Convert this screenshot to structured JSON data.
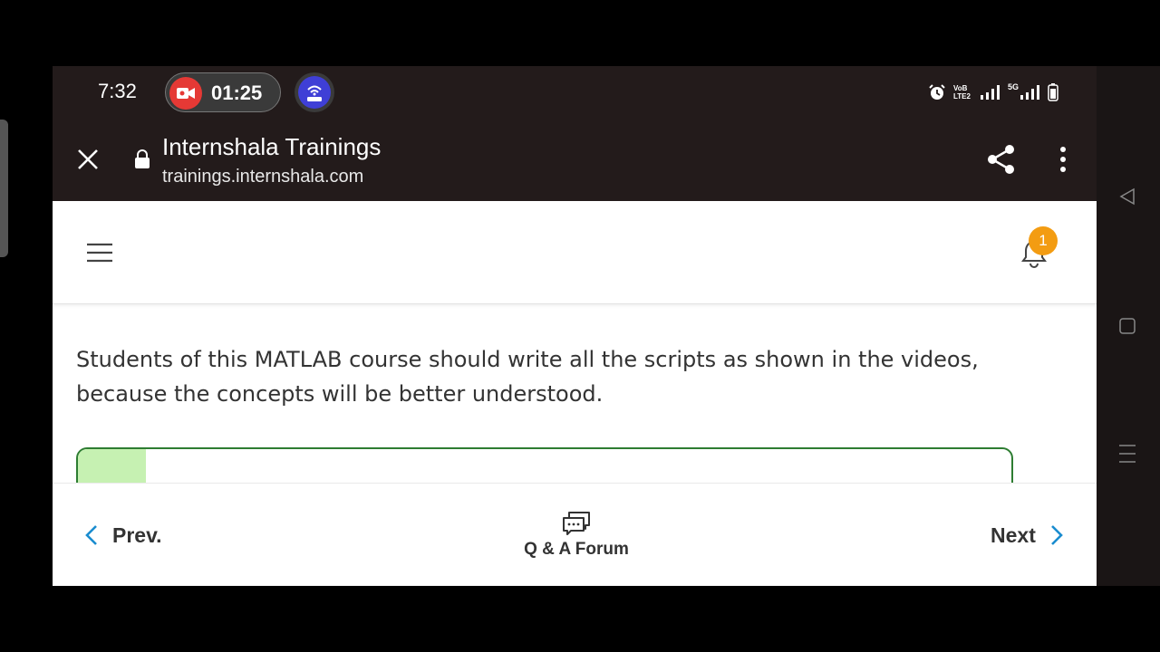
{
  "status_bar": {
    "time": "7:32",
    "recording_time": "01:25",
    "network_label": "VoB LTE2",
    "signal_label": "5G"
  },
  "custom_tab": {
    "title": "Internshala Trainings",
    "url": "trainings.internshala.com"
  },
  "page_header": {
    "notification_count": "1"
  },
  "content": {
    "paragraph": "Students of this MATLAB course should write all the scripts as shown in the videos, because the concepts will be better understood."
  },
  "bottom_nav": {
    "prev_label": "Prev.",
    "forum_label": "Q & A Forum",
    "next_label": "Next"
  },
  "colors": {
    "chrome_bg": "#231b1b",
    "accent_blue": "#1a8ccf",
    "badge_orange": "#f39c12",
    "quiz_border": "#2e7d32",
    "quiz_fill": "#c6f1b2"
  },
  "icons": [
    "close-icon",
    "lock-icon",
    "share-icon",
    "more-vert-icon",
    "menu-icon",
    "bell-icon",
    "chevron-left-icon",
    "chat-icon",
    "chevron-right-icon",
    "back-triangle-icon",
    "recents-square-icon",
    "home-lines-icon"
  ]
}
